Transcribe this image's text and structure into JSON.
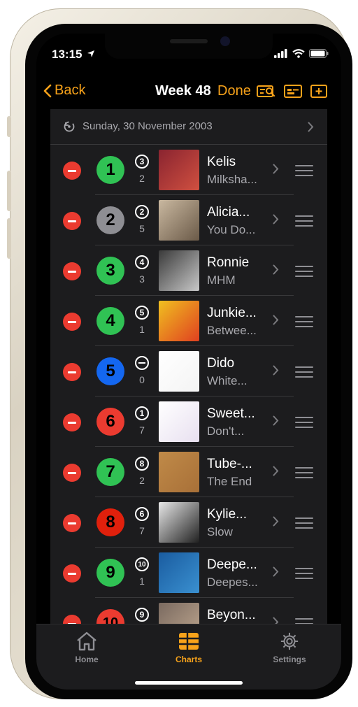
{
  "status": {
    "time": "13:15"
  },
  "nav": {
    "back_label": "Back",
    "title": "Week 48",
    "done_label": "Done"
  },
  "date_header": {
    "text": "Sunday, 30 November 2003"
  },
  "chart_rows": [
    {
      "rank": "1",
      "rank_color": "#30c254",
      "prev": "3",
      "weeks": "2",
      "artist": "Kelis",
      "title": "Milksha...",
      "art": [
        "#8a2430",
        "#d05040"
      ]
    },
    {
      "rank": "2",
      "rank_color": "#8e8e93",
      "prev": "2",
      "weeks": "5",
      "artist": "Alicia...",
      "title": "You Do...",
      "art": [
        "#c9b8a0",
        "#6b5a48"
      ]
    },
    {
      "rank": "3",
      "rank_color": "#30c254",
      "prev": "4",
      "weeks": "3",
      "artist": "Ronnie",
      "title": "MHM",
      "art": [
        "#3a3a3a",
        "#c8c8c8"
      ]
    },
    {
      "rank": "4",
      "rank_color": "#30c254",
      "prev": "5",
      "weeks": "1",
      "artist": "Junkie...",
      "title": "Betwee...",
      "art": [
        "#f0c020",
        "#e04020"
      ]
    },
    {
      "rank": "5",
      "rank_color": "#1467f0",
      "prev": "",
      "weeks": "0",
      "artist": "Dido",
      "title": "White...",
      "art": [
        "#ffffff",
        "#f4f4f4"
      ]
    },
    {
      "rank": "6",
      "rank_color": "#eb3b30",
      "prev": "1",
      "weeks": "7",
      "artist": "Sweet...",
      "title": "Don't...",
      "art": [
        "#ffffff",
        "#e8e0f0"
      ]
    },
    {
      "rank": "7",
      "rank_color": "#30c254",
      "prev": "8",
      "weeks": "2",
      "artist": "Tube-...",
      "title": "The End",
      "art": [
        "#c08a48",
        "#a87038"
      ]
    },
    {
      "rank": "8",
      "rank_color": "#e0200c",
      "prev": "6",
      "weeks": "7",
      "artist": "Kylie...",
      "title": "Slow",
      "art": [
        "#e8e8e8",
        "#202020"
      ]
    },
    {
      "rank": "9",
      "rank_color": "#30c254",
      "prev": "10",
      "weeks": "1",
      "artist": "Deepe...",
      "title": "Deepes...",
      "art": [
        "#1a5ca0",
        "#3a90d0"
      ]
    },
    {
      "rank": "10",
      "rank_color": "#eb3b30",
      "prev": "9",
      "weeks": "",
      "artist": "Beyon...",
      "title": "",
      "art": [
        "#7a6a60",
        "#c0a890"
      ]
    }
  ],
  "tabs": [
    {
      "label": "Home",
      "icon": "house-icon",
      "active": false
    },
    {
      "label": "Charts",
      "icon": "charts-grid-icon",
      "active": true
    },
    {
      "label": "Settings",
      "icon": "gear-icon",
      "active": false
    }
  ],
  "colors": {
    "accent": "#f7a21a",
    "delete": "#eb3b30",
    "background": "#1c1c1e"
  }
}
